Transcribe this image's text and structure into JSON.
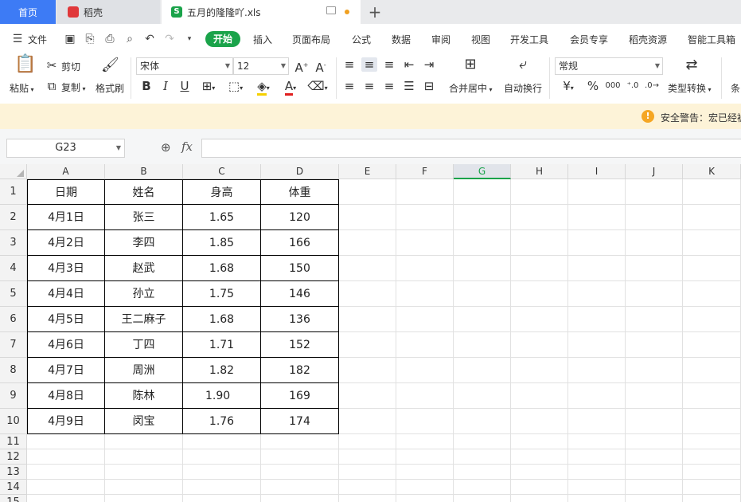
{
  "tabs": {
    "home": "首页",
    "daoke": "稻壳",
    "file": "五月的隆隆吖.xls",
    "file_logo": "S"
  },
  "menu": {
    "file": "文件",
    "items": [
      "开始",
      "插入",
      "页面布局",
      "公式",
      "数据",
      "审阅",
      "视图",
      "开发工具",
      "会员专享",
      "稻壳资源",
      "智能工具箱"
    ]
  },
  "ribbon": {
    "paste": "粘贴",
    "cut": "剪切",
    "copy": "复制",
    "format_painter": "格式刷",
    "font_name": "宋体",
    "font_size": "12",
    "merge_center": "合并居中",
    "wrap_text": "自动换行",
    "number_format": "常规",
    "type_convert": "类型转换",
    "condition_partial": "条",
    "currency": "¥",
    "percent": "%",
    "thousands": "000"
  },
  "warning": {
    "text": "安全警告：宏已经被"
  },
  "formula": {
    "namebox": "G23",
    "fx": "fx"
  },
  "colors": {
    "accent": "#1aa34a",
    "home_tab": "#3d7bf5",
    "warn_bg": "#fdf3d8",
    "warn_icon": "#f5a623"
  },
  "grid": {
    "columns": [
      "A",
      "B",
      "C",
      "D",
      "E",
      "F",
      "G",
      "H",
      "I",
      "J",
      "K"
    ],
    "selected_column": "G",
    "rows": [
      "1",
      "2",
      "3",
      "4",
      "5",
      "6",
      "7",
      "8",
      "9",
      "10",
      "11",
      "12",
      "13",
      "14",
      "15"
    ],
    "table": [
      [
        "日期",
        "姓名",
        "身高",
        "体重"
      ],
      [
        "4月1日",
        "张三",
        "1.65",
        "120"
      ],
      [
        "4月2日",
        "李四",
        "1.85",
        "166"
      ],
      [
        "4月3日",
        "赵武",
        "1.68",
        "150"
      ],
      [
        "4月4日",
        "孙立",
        "1.75",
        "146"
      ],
      [
        "4月5日",
        "王二麻子",
        "1.68",
        "136"
      ],
      [
        "4月6日",
        "丁四",
        "1.71",
        "152"
      ],
      [
        "4月7日",
        "周洲",
        "1.82",
        "182"
      ],
      [
        "4月8日",
        "陈林",
        "1.90",
        "169"
      ],
      [
        "4月9日",
        "闵宝",
        "1.76",
        "174"
      ]
    ]
  }
}
